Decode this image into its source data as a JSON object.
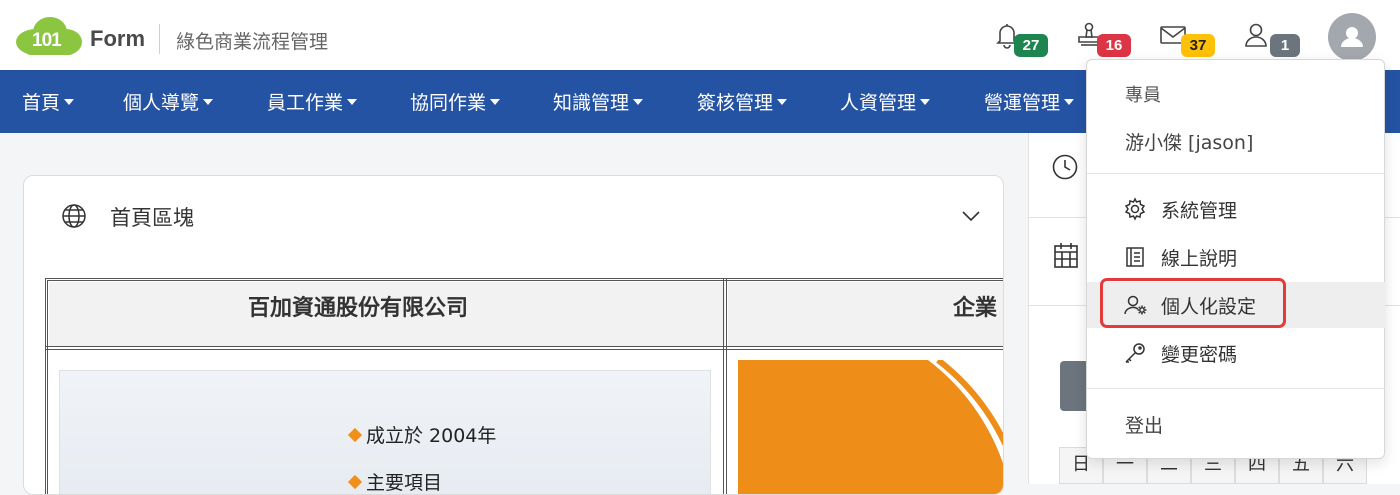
{
  "header": {
    "logo_number": "101",
    "logo_word": "Form",
    "subtitle": "綠色商業流程管理",
    "badges": {
      "notifications": "27",
      "approvals": "16",
      "messages": "37",
      "users": "1"
    },
    "badge_colors": {
      "notifications": "#1e8450",
      "approvals": "#dc3545",
      "messages": "#ffc107",
      "users": "#6c757d"
    }
  },
  "nav": {
    "items": [
      "首頁",
      "個人導覽",
      "員工作業",
      "協同作業",
      "知識管理",
      "簽核管理",
      "人資管理",
      "營運管理"
    ]
  },
  "main": {
    "card_title": "首頁區塊",
    "company_name": "百加資通股份有限公司",
    "col2_title": "企業",
    "slide_lines": [
      "成立於 2004年",
      "主要項目"
    ]
  },
  "dropdown": {
    "role": "專員",
    "user": "游小傑 [jason]",
    "items": [
      {
        "label": "系統管理",
        "icon": "gear-icon"
      },
      {
        "label": "線上說明",
        "icon": "book-icon"
      },
      {
        "label": "個人化設定",
        "icon": "user-gear-icon"
      },
      {
        "label": "變更密碼",
        "icon": "key-icon"
      }
    ],
    "logout": "登出"
  },
  "calendar": {
    "weekdays": [
      "日",
      "一",
      "二",
      "三",
      "四",
      "五",
      "六"
    ]
  }
}
